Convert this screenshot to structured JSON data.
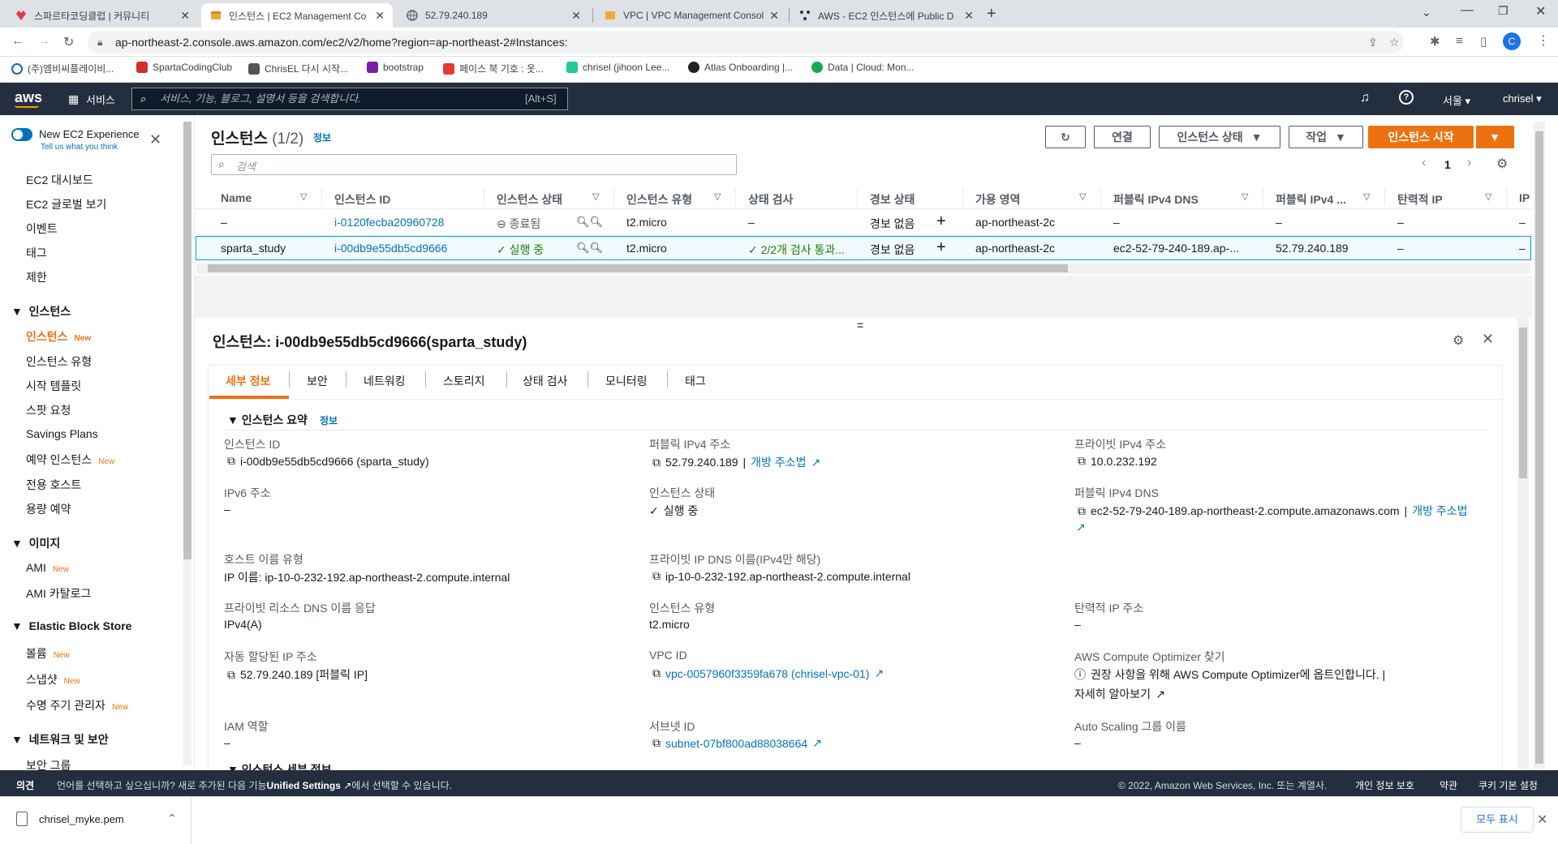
{
  "browser": {
    "tabs": [
      {
        "title": "스파르타코딩클럽 | 커뮤니티",
        "active": false
      },
      {
        "title": "인스턴스 | EC2 Management Co",
        "active": true
      },
      {
        "title": "52.79.240.189",
        "active": false
      },
      {
        "title": "VPC | VPC Management Consol",
        "active": false
      },
      {
        "title": "AWS - EC2 인스턴스에 Public D",
        "active": false
      }
    ],
    "url": "ap-northeast-2.console.aws.amazon.com/ec2/v2/home?region=ap-northeast-2#Instances:",
    "profile_initial": "C",
    "bookmarks": [
      "(주)엠비씨플레이비...",
      "SpartaCodingClub",
      "ChrisEL 다시 시작...",
      "bootstrap",
      "페이스 북 기호 : 옷...",
      "chrisel (jihoon Lee...",
      "Atlas Onboarding |...",
      "Data | Cloud: Mon..."
    ]
  },
  "aws": {
    "logo": "aws",
    "services": "서비스",
    "search_placeholder": "서비스, 기능, 블로그, 설명서 등을 검색합니다.",
    "search_shortcut": "[Alt+S]",
    "region": "서울",
    "user": "chrisel"
  },
  "sidebar": {
    "toggle_label": "New EC2 Experience",
    "toggle_sub": "Tell us what you think",
    "top_items": [
      "EC2 대시보드",
      "EC2 글로벌 보기",
      "이벤트",
      "태그",
      "제한"
    ],
    "sections": [
      {
        "title": "인스턴스",
        "items": [
          {
            "label": "인스턴스",
            "new": "New",
            "active": true
          },
          {
            "label": "인스턴스 유형"
          },
          {
            "label": "시작 템플릿"
          },
          {
            "label": "스팟 요청"
          },
          {
            "label": "Savings Plans"
          },
          {
            "label": "예약 인스턴스",
            "new": "New"
          },
          {
            "label": "전용 호스트"
          },
          {
            "label": "용량 예약"
          }
        ]
      },
      {
        "title": "이미지",
        "items": [
          {
            "label": "AMI",
            "new": "New"
          },
          {
            "label": "AMI 카탈로그"
          }
        ]
      },
      {
        "title": "Elastic Block Store",
        "items": [
          {
            "label": "볼륨",
            "new": "New"
          },
          {
            "label": "스냅샷",
            "new": "New"
          },
          {
            "label": "수명 주기 관리자",
            "new": "New"
          }
        ]
      },
      {
        "title": "네트워크 및 보안",
        "items": [
          {
            "label": "보안 그룹"
          }
        ]
      }
    ]
  },
  "instances": {
    "title": "인스턴스",
    "count": "(1/2)",
    "info": "정보",
    "connect": "연결",
    "state_btn": "인스턴스 상태",
    "actions_btn": "작업",
    "launch_btn": "인스턴스 시작",
    "search_placeholder": "검색",
    "page": "1",
    "columns": [
      "Name",
      "인스턴스 ID",
      "인스턴스 상태",
      "인스턴스 유형",
      "상태 검사",
      "경보 상태",
      "가용 영역",
      "퍼블릭 IPv4 DNS",
      "퍼블릭 IPv4 ...",
      "탄력적 IP",
      "IP"
    ],
    "rows": [
      {
        "name": "–",
        "id": "i-0120fecba20960728",
        "state": "종료됨",
        "type": "t2.micro",
        "check": "–",
        "alarm": "경보 없음",
        "az": "ap-northeast-2c",
        "dns": "–",
        "ip": "–",
        "eip": "–",
        "ipx": "–"
      },
      {
        "name": "sparta_study",
        "id": "i-00db9e55db5cd9666",
        "state": "실행 중",
        "type": "t2.micro",
        "check": "2/2개 검사 통과...",
        "alarm": "경보 없음",
        "az": "ap-northeast-2c",
        "dns": "ec2-52-79-240-189.ap-...",
        "ip": "52.79.240.189",
        "eip": "–",
        "ipx": "–"
      }
    ]
  },
  "detail": {
    "title": "인스턴스: i-00db9e55db5cd9666(sparta_study)",
    "tabs": [
      "세부 정보",
      "보안",
      "네트워킹",
      "스토리지",
      "상태 검사",
      "모니터링",
      "태그"
    ],
    "summary": "인스턴스 요약",
    "info": "정보",
    "next_section": "인스턴스 세부 정보",
    "fields": {
      "id_l": "인스턴스 ID",
      "id_v": "i-00db9e55db5cd9666 (sparta_study)",
      "pubip_l": "퍼블릭 IPv4 주소",
      "pubip_v": "52.79.240.189",
      "open_addr": "개방 주소법",
      "privip_l": "프라이빗 IPv4 주소",
      "privip_v": "10.0.232.192",
      "ipv6_l": "IPv6 주소",
      "ipv6_v": "–",
      "state_l": "인스턴스 상태",
      "state_v": "실행 중",
      "pubdns_l": "퍼블릭 IPv4 DNS",
      "pubdns_v": "ec2-52-79-240-189.ap-northeast-2.compute.amazonaws.com",
      "hostt_l": "호스트 이름 유형",
      "hostt_v": "IP 이름: ip-10-0-232-192.ap-northeast-2.compute.internal",
      "privdns_l": "프라이빗 IP DNS 이름(IPv4만 해당)",
      "privdns_v": "ip-10-0-232-192.ap-northeast-2.compute.internal",
      "resdns_l": "프라이빗 리소스 DNS 이름 응답",
      "resdns_v": "IPv4(A)",
      "itype_l": "인스턴스 유형",
      "itype_v": "t2.micro",
      "eip_l": "탄력적 IP 주소",
      "eip_v": "–",
      "autoip_l": "자동 할당된 IP 주소",
      "autoip_v": "52.79.240.189 [퍼블릭 IP]",
      "vpc_l": "VPC ID",
      "vpc_v": "vpc-0057960f3359fa678 (chrisel-vpc-01)",
      "opt_l": "AWS Compute Optimizer 찾기",
      "opt_v": "권장 사항을 위해 AWS Compute Optimizer에 옵트인합니다. |",
      "opt_link": "자세히 알아보기",
      "iam_l": "IAM 역할",
      "iam_v": "–",
      "subnet_l": "서브넷 ID",
      "subnet_v": "subnet-07bf800ad88038664",
      "asg_l": "Auto Scaling 그룹 이름",
      "asg_v": "–"
    }
  },
  "footer": {
    "feedback": "의견",
    "lang_msg": "언어를 선택하고 싶으십니까? 새로 추가된 다음 기능",
    "lang_link": "Unified Settings",
    "lang_msg2": "에서 선택할 수 있습니다.",
    "copyright": "© 2022, Amazon Web Services, Inc. 또는 계열사.",
    "privacy": "개인 정보 보호",
    "terms": "약관",
    "cookies": "쿠키 기본 설정"
  },
  "download": {
    "file": "chrisel_myke.pem",
    "show_all": "모두 표시"
  }
}
